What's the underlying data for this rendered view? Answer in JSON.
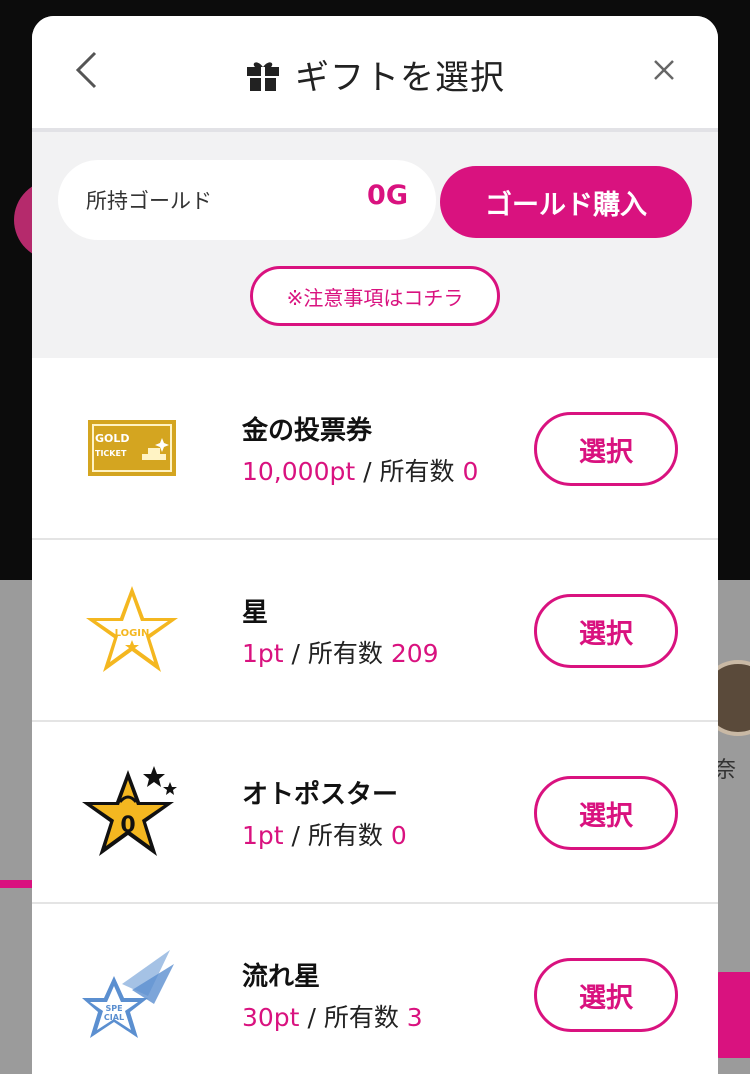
{
  "modal": {
    "title": "ギフトを選択",
    "icons": {
      "back": "chevron-left-icon",
      "gift": "gift-icon",
      "close": "close-icon"
    }
  },
  "gold": {
    "label": "所持ゴールド",
    "value": "0G",
    "buy_label": "ゴールド購入",
    "notice_label": "※注意事項はコチラ"
  },
  "gifts": [
    {
      "name": "金の投票券",
      "points": "10,000pt",
      "owned_label": "所有数",
      "owned": "0",
      "select_label": "選択",
      "icon": "gold-ticket-icon"
    },
    {
      "name": "星",
      "points": "1pt",
      "owned_label": "所有数",
      "owned": "209",
      "select_label": "選択",
      "icon": "login-star-icon"
    },
    {
      "name": "オトポスター",
      "points": "1pt",
      "owned_label": "所有数",
      "owned": "0",
      "select_label": "選択",
      "icon": "oto-star-icon"
    },
    {
      "name": "流れ星",
      "points": "30pt",
      "owned_label": "所有数",
      "owned": "3",
      "select_label": "選択",
      "icon": "shooting-star-icon"
    }
  ],
  "icon_text": {
    "gold_ticket_1": "GOLD",
    "gold_ticket_2": "TICKET",
    "login_star": "LOGIN",
    "oto_star": "0",
    "shooting_1": "SPE",
    "shooting_2": "CIAL"
  },
  "background": {
    "partial_name": "奈"
  },
  "colors": {
    "accent": "#d9127f",
    "gold": "#d4a520",
    "star_yellow": "#f4b720",
    "shooting_blue": "#5b8fd0"
  }
}
